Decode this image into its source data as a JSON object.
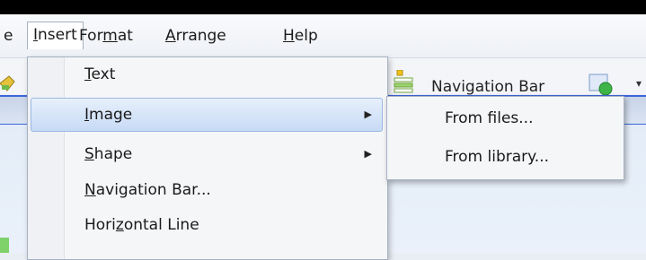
{
  "menubar": {
    "items": [
      {
        "label": "e"
      },
      {
        "label": "Insert",
        "underline": "I"
      },
      {
        "label": "Format",
        "underline": "m"
      },
      {
        "label": "Arrange",
        "underline": "A"
      },
      {
        "label": "Help",
        "underline": "H"
      }
    ]
  },
  "toolbar": {
    "navigation_bar_label": "Navigation Bar",
    "icons": [
      "toolbar-left-icon",
      "navigation-bar-icon",
      "insert-image-icon",
      "dropdown-arrow-icon"
    ]
  },
  "insert_menu": {
    "items": [
      {
        "label": "Text",
        "underline": "T",
        "has_submenu": false
      },
      {
        "label": "Image",
        "underline": "I",
        "has_submenu": true,
        "highlighted": true
      },
      {
        "label": "Shape",
        "underline": "S",
        "has_submenu": true
      },
      {
        "label": "Navigation Bar...",
        "underline": "N",
        "has_submenu": false
      },
      {
        "label": "Horizontal Line",
        "underline": "z",
        "has_submenu": false
      }
    ]
  },
  "image_submenu": {
    "items": [
      {
        "label": "From files..."
      },
      {
        "label": "From library..."
      }
    ]
  },
  "colors": {
    "highlight": "#c7daf5",
    "accent_rule": "#3d66d8"
  }
}
